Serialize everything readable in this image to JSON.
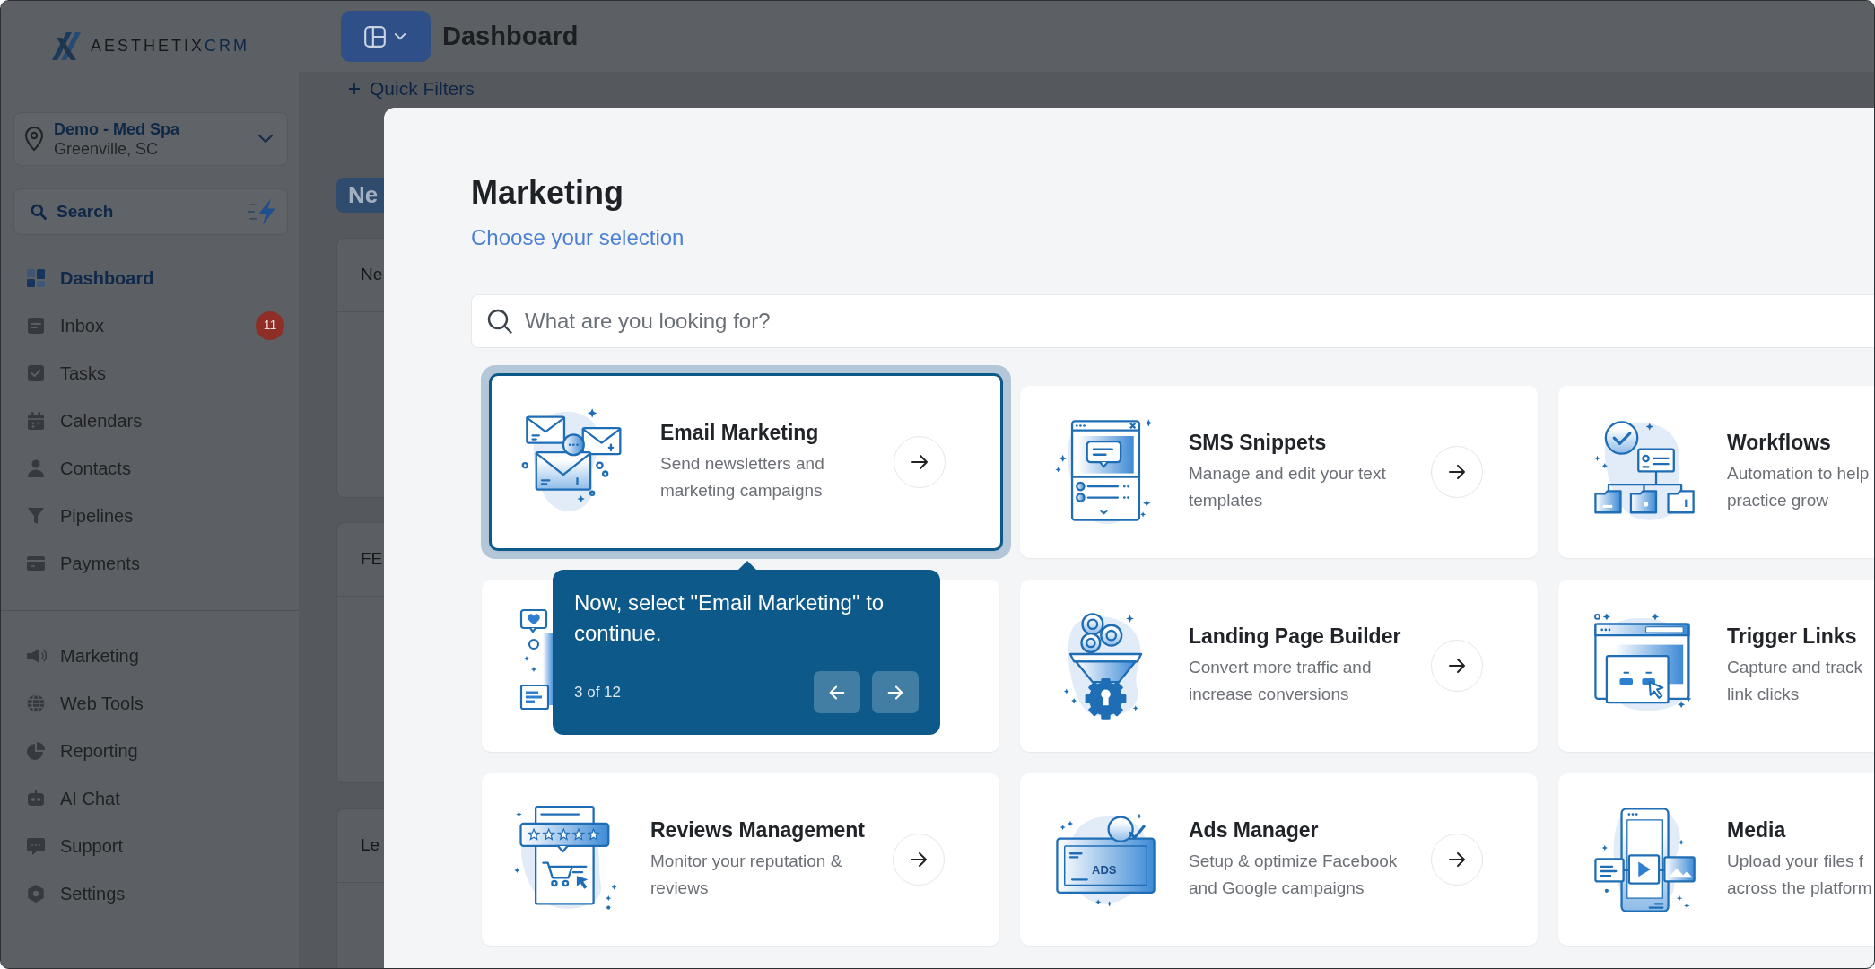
{
  "sidebar": {
    "logo": {
      "text": "AESTHETIX",
      "accent": "CRM"
    },
    "location": {
      "name": "Demo - Med Spa",
      "address": "Greenville, SC"
    },
    "search": {
      "label": "Search"
    },
    "nav_sections": [
      {
        "items": [
          {
            "label": "Dashboard",
            "selected": true
          },
          {
            "label": "Inbox",
            "selected": false,
            "badge": "11"
          },
          {
            "label": "Tasks",
            "selected": false
          },
          {
            "label": "Calendars",
            "selected": false
          },
          {
            "label": "Contacts",
            "selected": false
          },
          {
            "label": "Pipelines",
            "selected": false
          },
          {
            "label": "Payments",
            "selected": false
          }
        ]
      },
      {
        "items": [
          {
            "label": "Marketing",
            "selected": false
          },
          {
            "label": "Web Tools",
            "selected": false
          },
          {
            "label": "Reporting",
            "selected": false
          },
          {
            "label": "AI Chat",
            "selected": false
          },
          {
            "label": "Support",
            "selected": false
          },
          {
            "label": "Settings",
            "selected": false
          }
        ]
      }
    ]
  },
  "header": {
    "title": "Dashboard",
    "quick_filters": "Quick Filters"
  },
  "dashboard": {
    "new_button": "Ne",
    "cards": [
      {
        "title": "Ne"
      },
      {
        "title": "FE"
      },
      {
        "title": "Le"
      }
    ]
  },
  "modal": {
    "title": "Marketing",
    "subtitle": "Choose your selection",
    "search": {
      "placeholder": "What are you looking for?"
    },
    "cards": [
      {
        "kind": "option",
        "selected": true,
        "title": "Email Marketing",
        "description_lines": [
          "Send newsletters and",
          "marketing campaigns"
        ]
      },
      {
        "kind": "option",
        "selected": false,
        "title": "SMS Snippets",
        "description_lines": [
          "Manage and edit your text",
          "templates"
        ]
      },
      {
        "kind": "clipped",
        "selected": false,
        "title": "Workflows",
        "description_lines": [
          "Automation to help",
          "practice grow"
        ]
      },
      {
        "kind": "covered",
        "selected": false
      },
      {
        "kind": "option",
        "selected": false,
        "title": "Landing Page Builder",
        "description_lines": [
          "Convert more traffic and",
          "increase conversions"
        ]
      },
      {
        "kind": "clipped",
        "selected": false,
        "title": "Trigger Links",
        "description_lines": [
          "Capture and track",
          "link clicks"
        ]
      },
      {
        "kind": "option",
        "selected": false,
        "title": "Reviews Management",
        "description_lines": [
          "Monitor your reputation &",
          "reviews"
        ]
      },
      {
        "kind": "option",
        "selected": false,
        "title": "Ads Manager",
        "illustration_label": "ADS",
        "description_lines": [
          "Setup & optimize Facebook",
          "and Google campaigns"
        ]
      },
      {
        "kind": "clipped",
        "selected": false,
        "title": "Media",
        "description_lines": [
          "Upload your files f",
          "across the platform"
        ]
      }
    ]
  },
  "tour_tooltip": {
    "text": "Now, select \"Email Marketing\" to continue.",
    "progress": "3 of 12"
  }
}
